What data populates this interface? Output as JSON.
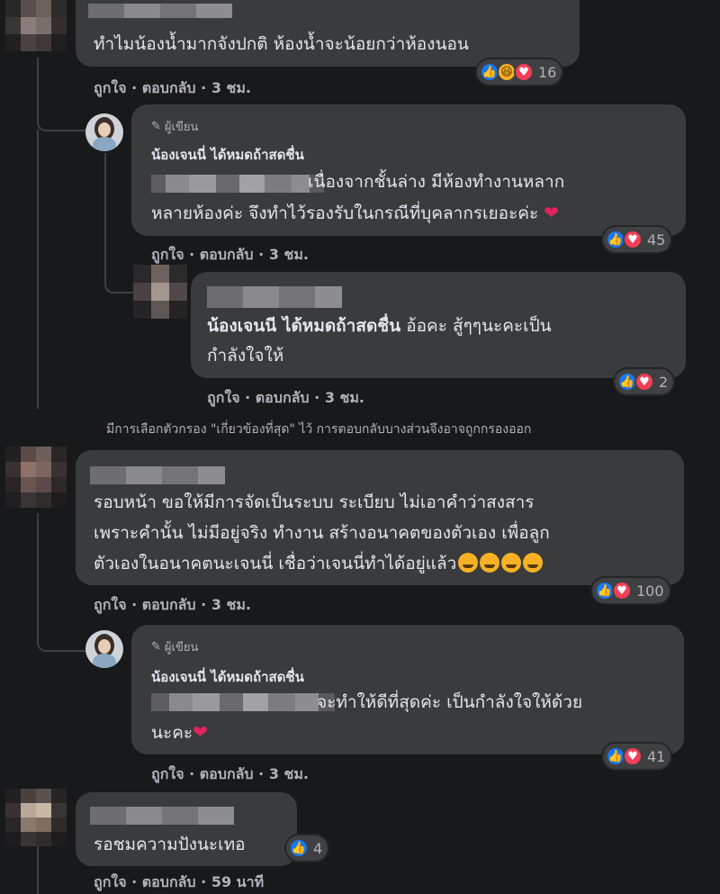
{
  "colors": {
    "background": "#18191a",
    "bubble": "#3a3b3c",
    "text": "#e4e6eb",
    "secondary": "#b0b3b8",
    "like": "#1877f2",
    "love": "#f33e58"
  },
  "action_labels": {
    "like": "ถูกใจ",
    "sep": " · ",
    "reply": "ตอบกลับ"
  },
  "comments": [
    {
      "text_lines": [
        "ทำไมน้องน้ำมากจังปกติ ห้องน้ำจะน้อยกว่าห้องนอน"
      ],
      "time": "3 ชม.",
      "reactions": [
        "like",
        "haha",
        "love"
      ],
      "count": "16"
    },
    {
      "badge": "ผู้เขียน",
      "author": "น้องเจนนี่ ได้หมดถ้าสดชื่น",
      "text_lines": [
        "เนื่องจากชั้นล่าง มีห้องทำงานหลาก",
        "หลายห้องค่ะ จึงทำไว้รองรับในกรณีที่บุคลากรเยอะค่ะ"
      ],
      "time": "3 ชม.",
      "reactions": [
        "like",
        "love"
      ],
      "count": "45"
    },
    {
      "mention": "น้องเจนนี ได้หมดถ้าสดชื่น",
      "text_lines": [
        "อ้อคะ สู้ๆๆนะคะเป็น",
        "กำลังใจให้"
      ],
      "time": "3 ชม.",
      "reactions": [
        "like",
        "love"
      ],
      "count": "2"
    },
    {
      "text_lines": [
        "รอบหน้า ขอให้มีการจัดเป็นระบบ ระเบียบ ไม่เอาคำว่าสงสาร",
        "เพราะคำนั้น ไม่มีอยู่จริง ทำงาน สร้างอนาคตของตัวเอง เพื่อลูก",
        "ตัวเองในอนาคตนะเจนนี่ เชื่อว่าเจนนี่ทำได้อยู่แล้ว"
      ],
      "time": "3 ชม.",
      "reactions": [
        "like",
        "love"
      ],
      "count": "100"
    },
    {
      "badge": "ผู้เขียน",
      "author": "น้องเจนนี่ ได้หมดถ้าสดชื่น",
      "text_lines": [
        "จะทำให้ดีที่สุดค่ะ เป็นกำลังใจให้ด้วย",
        "นะคะ"
      ],
      "time": "3 ชม.",
      "reactions": [
        "like",
        "love"
      ],
      "count": "41"
    },
    {
      "text_lines": [
        "รอชมความปังนะเทอ"
      ],
      "time": "59 นาที",
      "reactions": [
        "like"
      ],
      "count": "4"
    }
  ],
  "filter_notice": "มีการเลือกตัวกรอง \"เกี่ยวข้องที่สุด\" ไว้ การตอบกลับบางส่วนจึงอาจถูกกรองออก"
}
